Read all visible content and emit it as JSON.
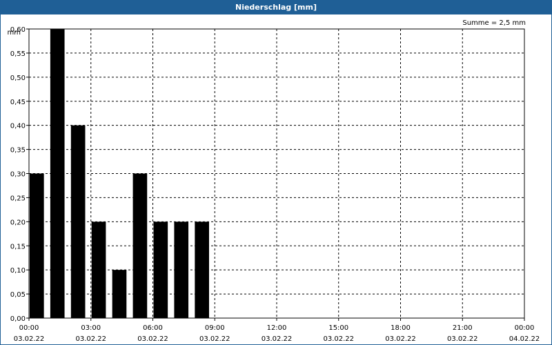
{
  "header": {
    "title": "Niederschlag [mm]"
  },
  "chart_data": {
    "type": "bar",
    "title": "Niederschlag [mm]",
    "annotation": "Summe = 2,5 mm",
    "ylabel": "mm",
    "xlabel": "",
    "ylim": [
      0,
      0.6
    ],
    "y_ticks": [
      "0,00",
      "0,05",
      "0,10",
      "0,15",
      "0,20",
      "0,25",
      "0,30",
      "0,35",
      "0,40",
      "0,45",
      "0,50",
      "0,55",
      "0,60"
    ],
    "x_ticks": [
      {
        "time": "00:00",
        "date": "03.02.22"
      },
      {
        "time": "03:00",
        "date": "03.02.22"
      },
      {
        "time": "06:00",
        "date": "03.02.22"
      },
      {
        "time": "09:00",
        "date": "03.02.22"
      },
      {
        "time": "12:00",
        "date": "03.02.22"
      },
      {
        "time": "15:00",
        "date": "03.02.22"
      },
      {
        "time": "18:00",
        "date": "03.02.22"
      },
      {
        "time": "21:00",
        "date": "03.02.22"
      },
      {
        "time": "00:00",
        "date": "04.02.22"
      }
    ],
    "categories": [
      "00:00",
      "01:00",
      "02:00",
      "03:00",
      "04:00",
      "05:00",
      "06:00",
      "07:00",
      "08:00"
    ],
    "values": [
      0.3,
      0.6,
      0.4,
      0.2,
      0.1,
      0.3,
      0.2,
      0.2,
      0.2
    ],
    "grid": true,
    "colors": {
      "bar": "#000000",
      "frame": "#1f5f96",
      "grid": "#000000"
    }
  }
}
